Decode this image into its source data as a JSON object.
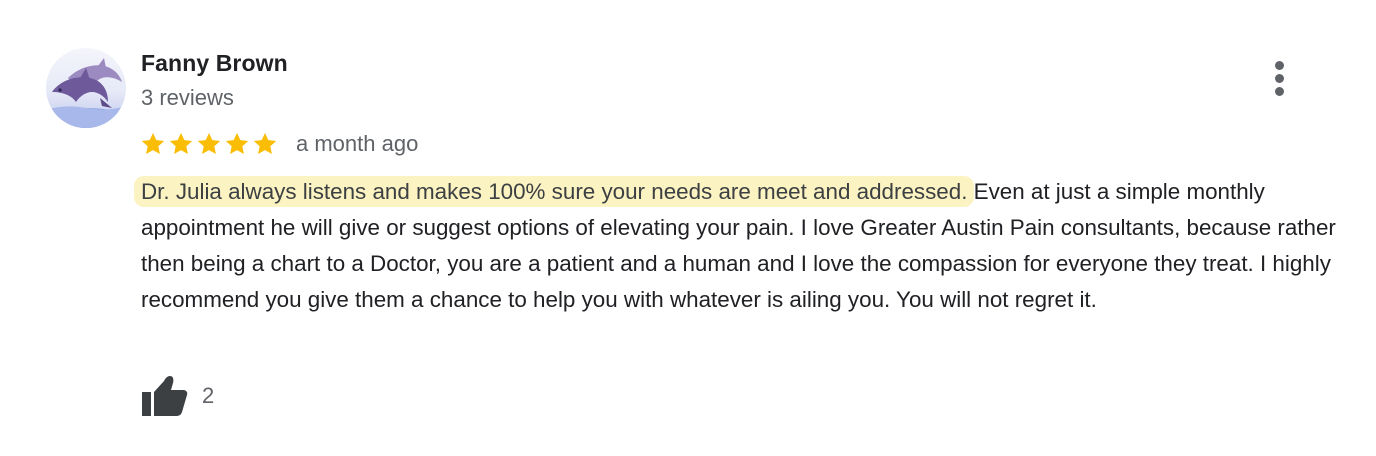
{
  "reviewer": {
    "name": "Fanny Brown",
    "reviews": "3 reviews",
    "avatar_icon": "dolphin-avatar-icon"
  },
  "rating": {
    "stars": 5,
    "max": 5,
    "star_color": "#fbbc04",
    "time": "a month ago"
  },
  "review": {
    "highlight": "Dr. Julia always listens and makes 100% sure your needs are meet and addressed.",
    "rest": " Even at just a simple monthly appointment he will give or suggest options of elevating your pain. I love Greater Austin Pain consultants, because rather then being a chart to a Doctor, you are a patient and a human and I love the compassion for everyone they treat. I highly recommend you give them a chance to help you with whatever is ailing you. You will not regret it.",
    "highlight_color": "#fcf3c2"
  },
  "actions": {
    "like_icon": "thumbs-up-icon",
    "like_count": "2",
    "menu_icon": "more-vertical-icon"
  }
}
